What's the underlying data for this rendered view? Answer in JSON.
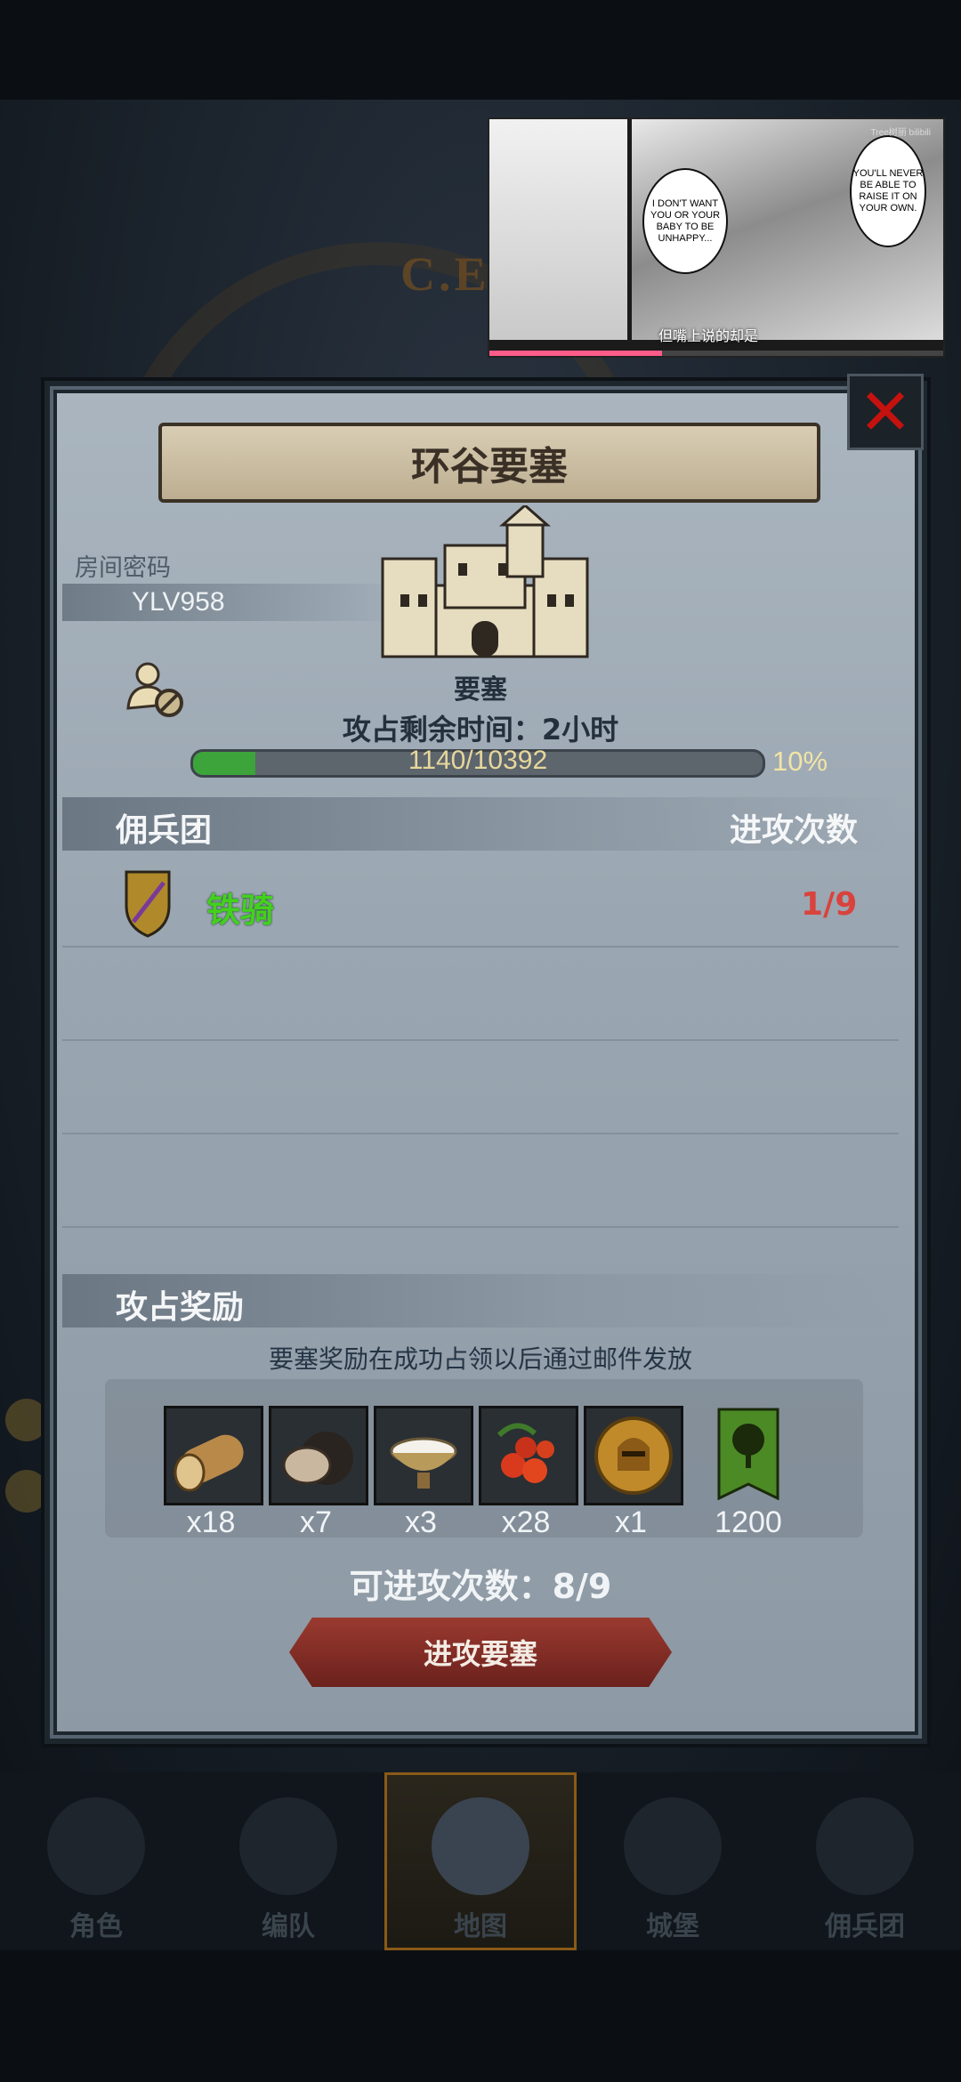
{
  "video_overlay": {
    "bubble1": "I DON'T WANT YOU OR YOUR BABY TO BE UNHAPPY...",
    "bubble2": "YOU'LL NEVER BE ABLE TO RAISE IT ON YOUR OWN.",
    "subtitle": "但嘴上说的却是",
    "brand": "Tree树丽 bilibili",
    "progress": 0.38
  },
  "background": {
    "emblem_text": "C.E.I"
  },
  "panel": {
    "title": "环谷要塞",
    "room_label": "房间密码",
    "room_code": "YLV958",
    "fortress_type": "要塞",
    "time_left": "攻占剩余时间：2小时",
    "progress_text": "1140/10392",
    "progress_current": 1140,
    "progress_total": 10392,
    "progress_percent": "10%",
    "mercenary_header": "佣兵团",
    "attack_count_header": "进攻次数",
    "mercenaries": [
      {
        "name": "铁骑",
        "count": "1/9"
      }
    ],
    "reward_header": "攻占奖励",
    "reward_note": "要塞奖励在成功占领以后通过邮件发放",
    "rewards": [
      {
        "icon": "wood-log-icon",
        "amount": "x18"
      },
      {
        "icon": "truffle-icon",
        "amount": "x7"
      },
      {
        "icon": "milk-bowl-icon",
        "amount": "x3"
      },
      {
        "icon": "berries-icon",
        "amount": "x28"
      },
      {
        "icon": "knight-coin-icon",
        "amount": "x1"
      },
      {
        "icon": "tree-banner-icon",
        "amount": "1200"
      }
    ],
    "attempts_left": "可进攻次数：8/9",
    "attack_button": "进攻要塞"
  },
  "nav": {
    "items": [
      {
        "label": "角色"
      },
      {
        "label": "编队"
      },
      {
        "label": "地图"
      },
      {
        "label": "城堡"
      },
      {
        "label": "佣兵团"
      }
    ],
    "active_index": 2
  },
  "colors": {
    "accent_red": "#c5120f",
    "merc_green": "#43d11d",
    "count_red": "#d9433d",
    "progress_green": "#3ca43b"
  }
}
